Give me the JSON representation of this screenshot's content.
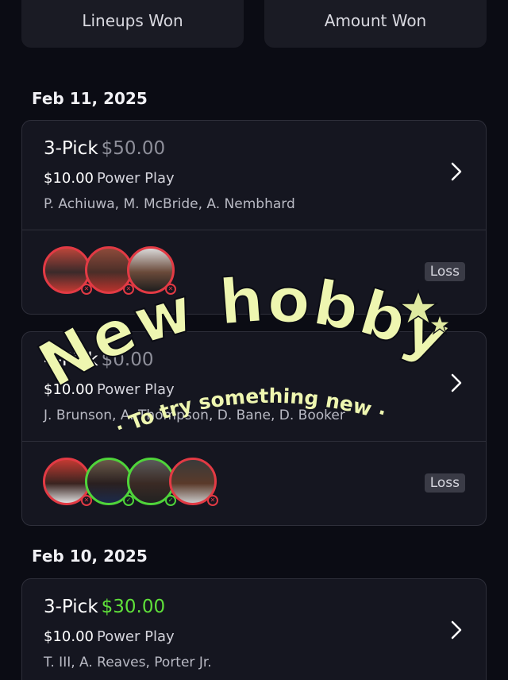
{
  "summary": {
    "lineups_won_label": "Lineups Won",
    "amount_won_label": "Amount Won"
  },
  "sections": [
    {
      "date": "Feb 11, 2025",
      "lineups": [
        {
          "title": "3-Pick",
          "amount": "$50.00",
          "amount_color": "#8e8f9a",
          "stake": "$10.00",
          "mode": "Power Play",
          "players": "P. Achiuwa, M. McBride, A. Nembhard",
          "result": "Loss",
          "pick_outcomes": [
            "loss",
            "loss",
            "loss"
          ]
        },
        {
          "title": "4-Pick",
          "amount": "$0.00",
          "amount_color": "#8e8f9a",
          "stake": "$10.00",
          "mode": "Power Play",
          "players": "J. Brunson, A. Thompson, D. Bane, D. Booker",
          "result": "Loss",
          "pick_outcomes": [
            "loss",
            "win",
            "win",
            "loss"
          ]
        }
      ]
    },
    {
      "date": "Feb 10, 2025",
      "lineups": [
        {
          "title": "3-Pick",
          "amount": "$30.00",
          "amount_color": "#5fe03a",
          "stake": "$10.00",
          "mode": "Power Play",
          "players": "T. III, A. Reaves, Porter Jr."
        }
      ]
    }
  ],
  "sticker": {
    "headline": "New hobby",
    "tagline": "· To try something new ·",
    "color": "#eef6b0"
  },
  "colors": {
    "background": "#0b0c14",
    "card": "#151620",
    "loss": "#e23a44",
    "win": "#4fd43a"
  }
}
